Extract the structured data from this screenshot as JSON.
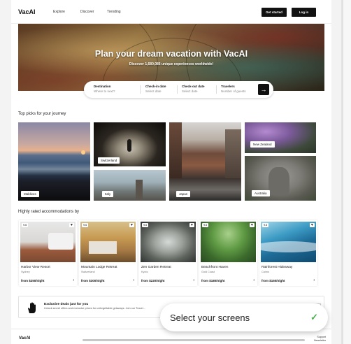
{
  "header": {
    "logo": "VacAI",
    "nav": [
      "Explore",
      "Discover",
      "Trending"
    ],
    "get_started": "Get started",
    "login": "Log in"
  },
  "hero": {
    "title": "Plan your dream vacation with VacAI",
    "subtitle": "Discover 1,680,086 unique experiences worldwide!"
  },
  "search": {
    "fields": [
      {
        "label": "Destination",
        "placeholder": "Where to next?"
      },
      {
        "label": "Check-in date",
        "placeholder": "Select date"
      },
      {
        "label": "Check-out date",
        "placeholder": "Select date"
      },
      {
        "label": "Travelers",
        "placeholder": "Number of guests"
      }
    ],
    "button_icon": "→"
  },
  "top_picks": {
    "title": "Top picks for your journey",
    "destinations": [
      "Maldives",
      "Switzerland",
      "Italy",
      "Japan",
      "New Zealand",
      "Australia"
    ]
  },
  "accommodations": {
    "title": "Highly rated accommodations by",
    "items": [
      {
        "rating": "9.6",
        "name": "Harbor View Resort",
        "location": "Sydney",
        "price": "from $250/night"
      },
      {
        "rating": "9.6",
        "name": "Mountain Lodge Retreat",
        "location": "Switzerland",
        "price": "from $300/night"
      },
      {
        "rating": "9.6",
        "name": "Zen Garden Retreat",
        "location": "Kyoto",
        "price": "from $220/night"
      },
      {
        "rating": "9.6",
        "name": "Beachfront Haven",
        "location": "Gold Coast",
        "price": "from $180/night"
      },
      {
        "rating": "9.6",
        "name": "Rainforest Hideaway",
        "location": "Cairns",
        "price": "from $150/night"
      }
    ]
  },
  "deals": {
    "title": "Exclusive deals just for you",
    "text": "Unlock secret offers and exclusive prices for unforgettable getaways. Join our Travel..."
  },
  "footer": {
    "logo": "VacAI",
    "links": [
      "Support",
      "Newsletter"
    ]
  },
  "toast": {
    "text": "Select your screens"
  },
  "colors": {
    "accent": "#111111",
    "check": "#4caf50"
  }
}
